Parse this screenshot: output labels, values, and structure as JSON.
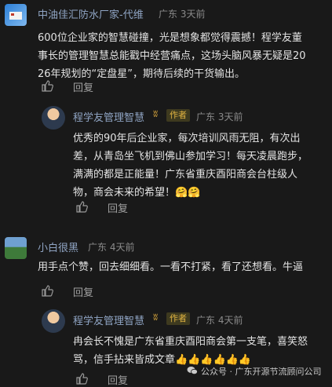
{
  "comments": [
    {
      "name": "中油佳汇防水厂家-代维",
      "meta": "广东 3天前",
      "lines": [
        "600位企业家的智慧碰撞，光是想象都觉得震撼！程学友董",
        "事长的管理智慧总能戳中经营痛点，这场头脑风暴无疑是20",
        "26年规划的“定盘星”，期待后续的干货输出。"
      ],
      "reply": "回复",
      "sub": {
        "name": "程学友管理智慧",
        "author_badge": "作者",
        "meta": "广东 3天前",
        "lines": [
          "优秀的90年后企业家，每次培训风雨无阻，有次出",
          "差，从青岛坐飞机到佛山参加学习！每天凌晨跑步，",
          "满满的都是正能量！广东省重庆酉阳商会台柱级人",
          "物，商会未来的希望！🤗🤗"
        ],
        "reply": "回复"
      }
    },
    {
      "name": "小白很黑",
      "meta": "广东 4天前",
      "lines": [
        "用手点个赞，回去细细看。一看不打紧，看了还想看。牛逼"
      ],
      "reply": "回复",
      "sub": {
        "name": "程学友管理智慧",
        "author_badge": "作者",
        "meta": "广东 4天前",
        "lines": [
          "冉会长不愧是广东省重庆酉阳商会第一支笔，喜笑怒",
          "骂，信手拈来皆成文章👍👍👍👍👍👍"
        ],
        "reply": "回复"
      }
    }
  ],
  "watermark": "公众号 · 广东开源节流顾问公司",
  "colors": {
    "background": "#191919",
    "name": "#8fa4c3",
    "author_badge": "#e0b341"
  },
  "icons": {
    "like": "thumbs-up-icon",
    "author_mark": "laurel-icon",
    "watermark": "wechat-icon"
  }
}
